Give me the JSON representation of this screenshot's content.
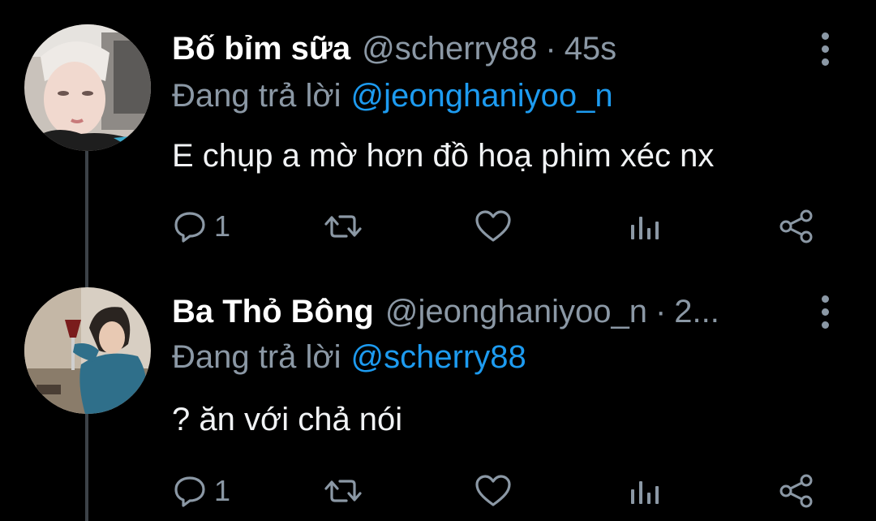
{
  "colors": {
    "background": "#000000",
    "primary_text": "#ffffff",
    "secondary_text": "#8b98a5",
    "link": "#1d9bf0",
    "thread_line": "#3c4248"
  },
  "tweets": [
    {
      "display_name": "Bố bỉm sữa",
      "handle": "@scherry88",
      "separator": "·",
      "time": "45s",
      "reply_prefix": "Đang trả lời",
      "reply_to": "@jeonghaniyoo_n",
      "text": "E chụp a mờ hơn đồ hoạ phim xéc nx",
      "actions": {
        "reply": {
          "icon": "reply-icon",
          "count": "1"
        },
        "retweet": {
          "icon": "retweet-icon"
        },
        "like": {
          "icon": "heart-icon"
        },
        "analytics": {
          "icon": "analytics-icon"
        },
        "share": {
          "icon": "share-icon"
        }
      },
      "more_icon": "more-vertical-icon",
      "avatar": "avatar-photo"
    },
    {
      "display_name": "Ba Thỏ Bông",
      "handle": "@jeonghaniyoo_n",
      "separator": "·",
      "time": "2...",
      "reply_prefix": "Đang trả lời",
      "reply_to": "@scherry88",
      "text": "? ăn với chả nói",
      "actions": {
        "reply": {
          "icon": "reply-icon",
          "count": "1"
        },
        "retweet": {
          "icon": "retweet-icon"
        },
        "like": {
          "icon": "heart-icon"
        },
        "analytics": {
          "icon": "analytics-icon"
        },
        "share": {
          "icon": "share-icon"
        }
      },
      "more_icon": "more-vertical-icon",
      "avatar": "avatar-photo"
    }
  ]
}
